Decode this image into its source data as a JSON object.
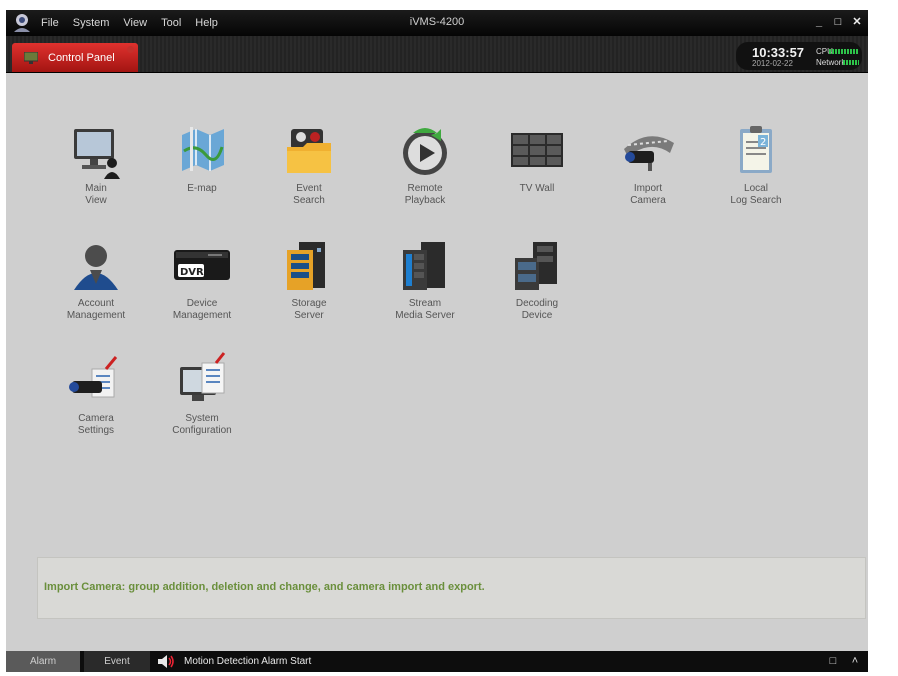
{
  "window": {
    "title": "iVMS-4200",
    "menu": [
      "File",
      "System",
      "View",
      "Tool",
      "Help"
    ]
  },
  "tabs": {
    "active_label": "Control Panel"
  },
  "clock": {
    "time": "10:33:57",
    "date": "2012-02-22",
    "cpu_label": "CPU",
    "network_label": "Network"
  },
  "tiles": [
    {
      "label": "Main\nView",
      "icon": "monitor-icon"
    },
    {
      "label": "E-map",
      "icon": "map-icon"
    },
    {
      "label": "Event\nSearch",
      "icon": "event-folder-icon"
    },
    {
      "label": "Remote\nPlayback",
      "icon": "playback-icon"
    },
    {
      "label": "TV Wall",
      "icon": "tv-wall-icon"
    },
    {
      "label": "Import\nCamera",
      "icon": "import-camera-icon"
    },
    {
      "label": "Local\nLog Search",
      "icon": "log-clipboard-icon"
    },
    {
      "label": "Account\nManagement",
      "icon": "user-icon"
    },
    {
      "label": "Device\nManagement",
      "icon": "dvr-icon"
    },
    {
      "label": "Storage\nServer",
      "icon": "storage-server-icon"
    },
    {
      "label": "Stream\nMedia Server",
      "icon": "stream-server-icon"
    },
    {
      "label": "Decoding\nDevice",
      "icon": "decoding-device-icon"
    },
    {
      "label": "Camera\nSettings",
      "icon": "camera-settings-icon"
    },
    {
      "label": "System\nConfiguration",
      "icon": "system-config-icon"
    }
  ],
  "dvr_text": "DVR",
  "description": "Import Camera: group addition, deletion and change, and camera import and export.",
  "statusbar": {
    "alarm_tab": "Alarm",
    "event_tab": "Event",
    "message": "Motion Detection Alarm  Start"
  },
  "colors": {
    "accent_red": "#c8201c",
    "background": "#cfcfcf",
    "description_text": "#6a8f3c",
    "status_green": "#2ec44a"
  }
}
